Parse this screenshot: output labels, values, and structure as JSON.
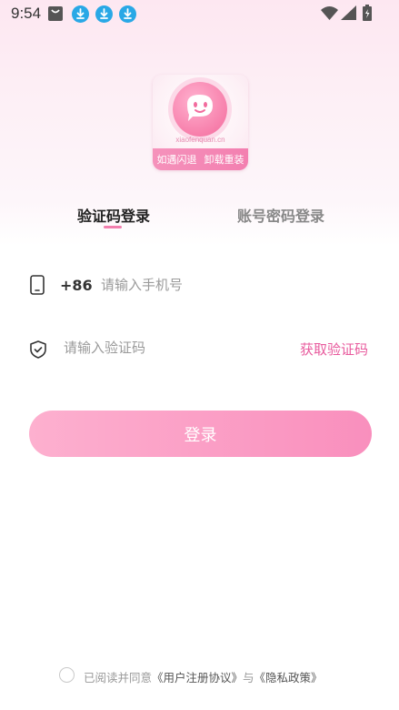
{
  "status_bar": {
    "time": "9:54",
    "notification_icons": [
      "shopping-bag-icon",
      "download-icon",
      "download-icon",
      "download-icon"
    ],
    "right_icons": [
      "wifi-icon",
      "signal-icon",
      "battery-icon"
    ]
  },
  "app_logo": {
    "domain_text": "xiaofenquan.cn",
    "band_left": "如遇闪退",
    "band_right": "卸载重装"
  },
  "tabs": [
    {
      "label": "验证码登录",
      "active": true
    },
    {
      "label": "账号密码登录",
      "active": false
    }
  ],
  "phone_field": {
    "prefix": "+86",
    "value": "",
    "placeholder": "请输入手机号"
  },
  "code_field": {
    "value": "",
    "placeholder": "请输入验证码",
    "get_code_label": "获取验证码"
  },
  "login_button": {
    "label": "登录"
  },
  "agreement": {
    "prefix": "已阅读并同意",
    "user_agreement": "《用户注册协议》",
    "and": "与",
    "privacy_policy": "《隐私政策》"
  },
  "colors": {
    "accent": "#e85a9d",
    "button_start": "#fdb0cf",
    "button_end": "#f98fbd",
    "tab_underline": "#f27fae"
  }
}
